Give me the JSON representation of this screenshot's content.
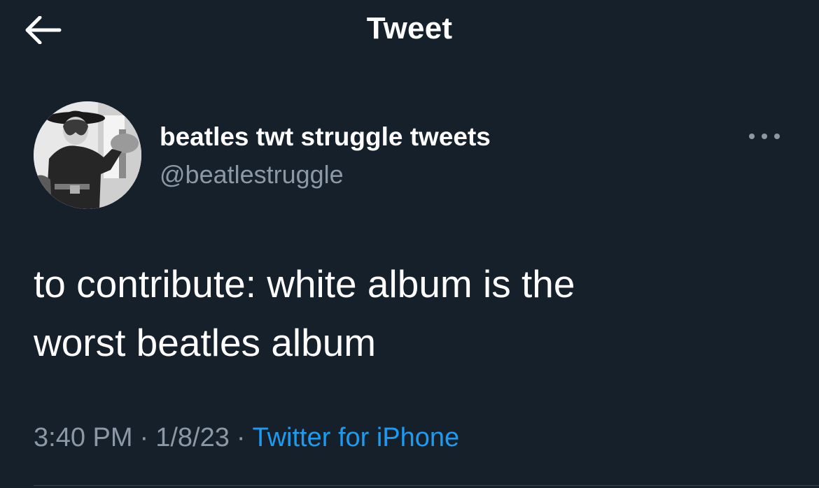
{
  "header": {
    "title": "Tweet",
    "back_icon": "arrow-left-icon"
  },
  "author": {
    "display_name": "beatles twt struggle tweets",
    "handle": "@beatlestruggle",
    "avatar": "profile-photo",
    "more_icon": "more-horizontal-icon"
  },
  "tweet": {
    "text_line1": "to contribute: white album is the",
    "text_line2": "worst beatles album"
  },
  "meta": {
    "time": "3:40 PM",
    "separator": "·",
    "date": "1/8/23",
    "source": "Twitter for iPhone"
  },
  "colors": {
    "background": "#15202b",
    "text_primary": "#ffffff",
    "text_secondary": "#8b98a5",
    "accent": "#1d9bf0",
    "divider": "#38444d"
  }
}
